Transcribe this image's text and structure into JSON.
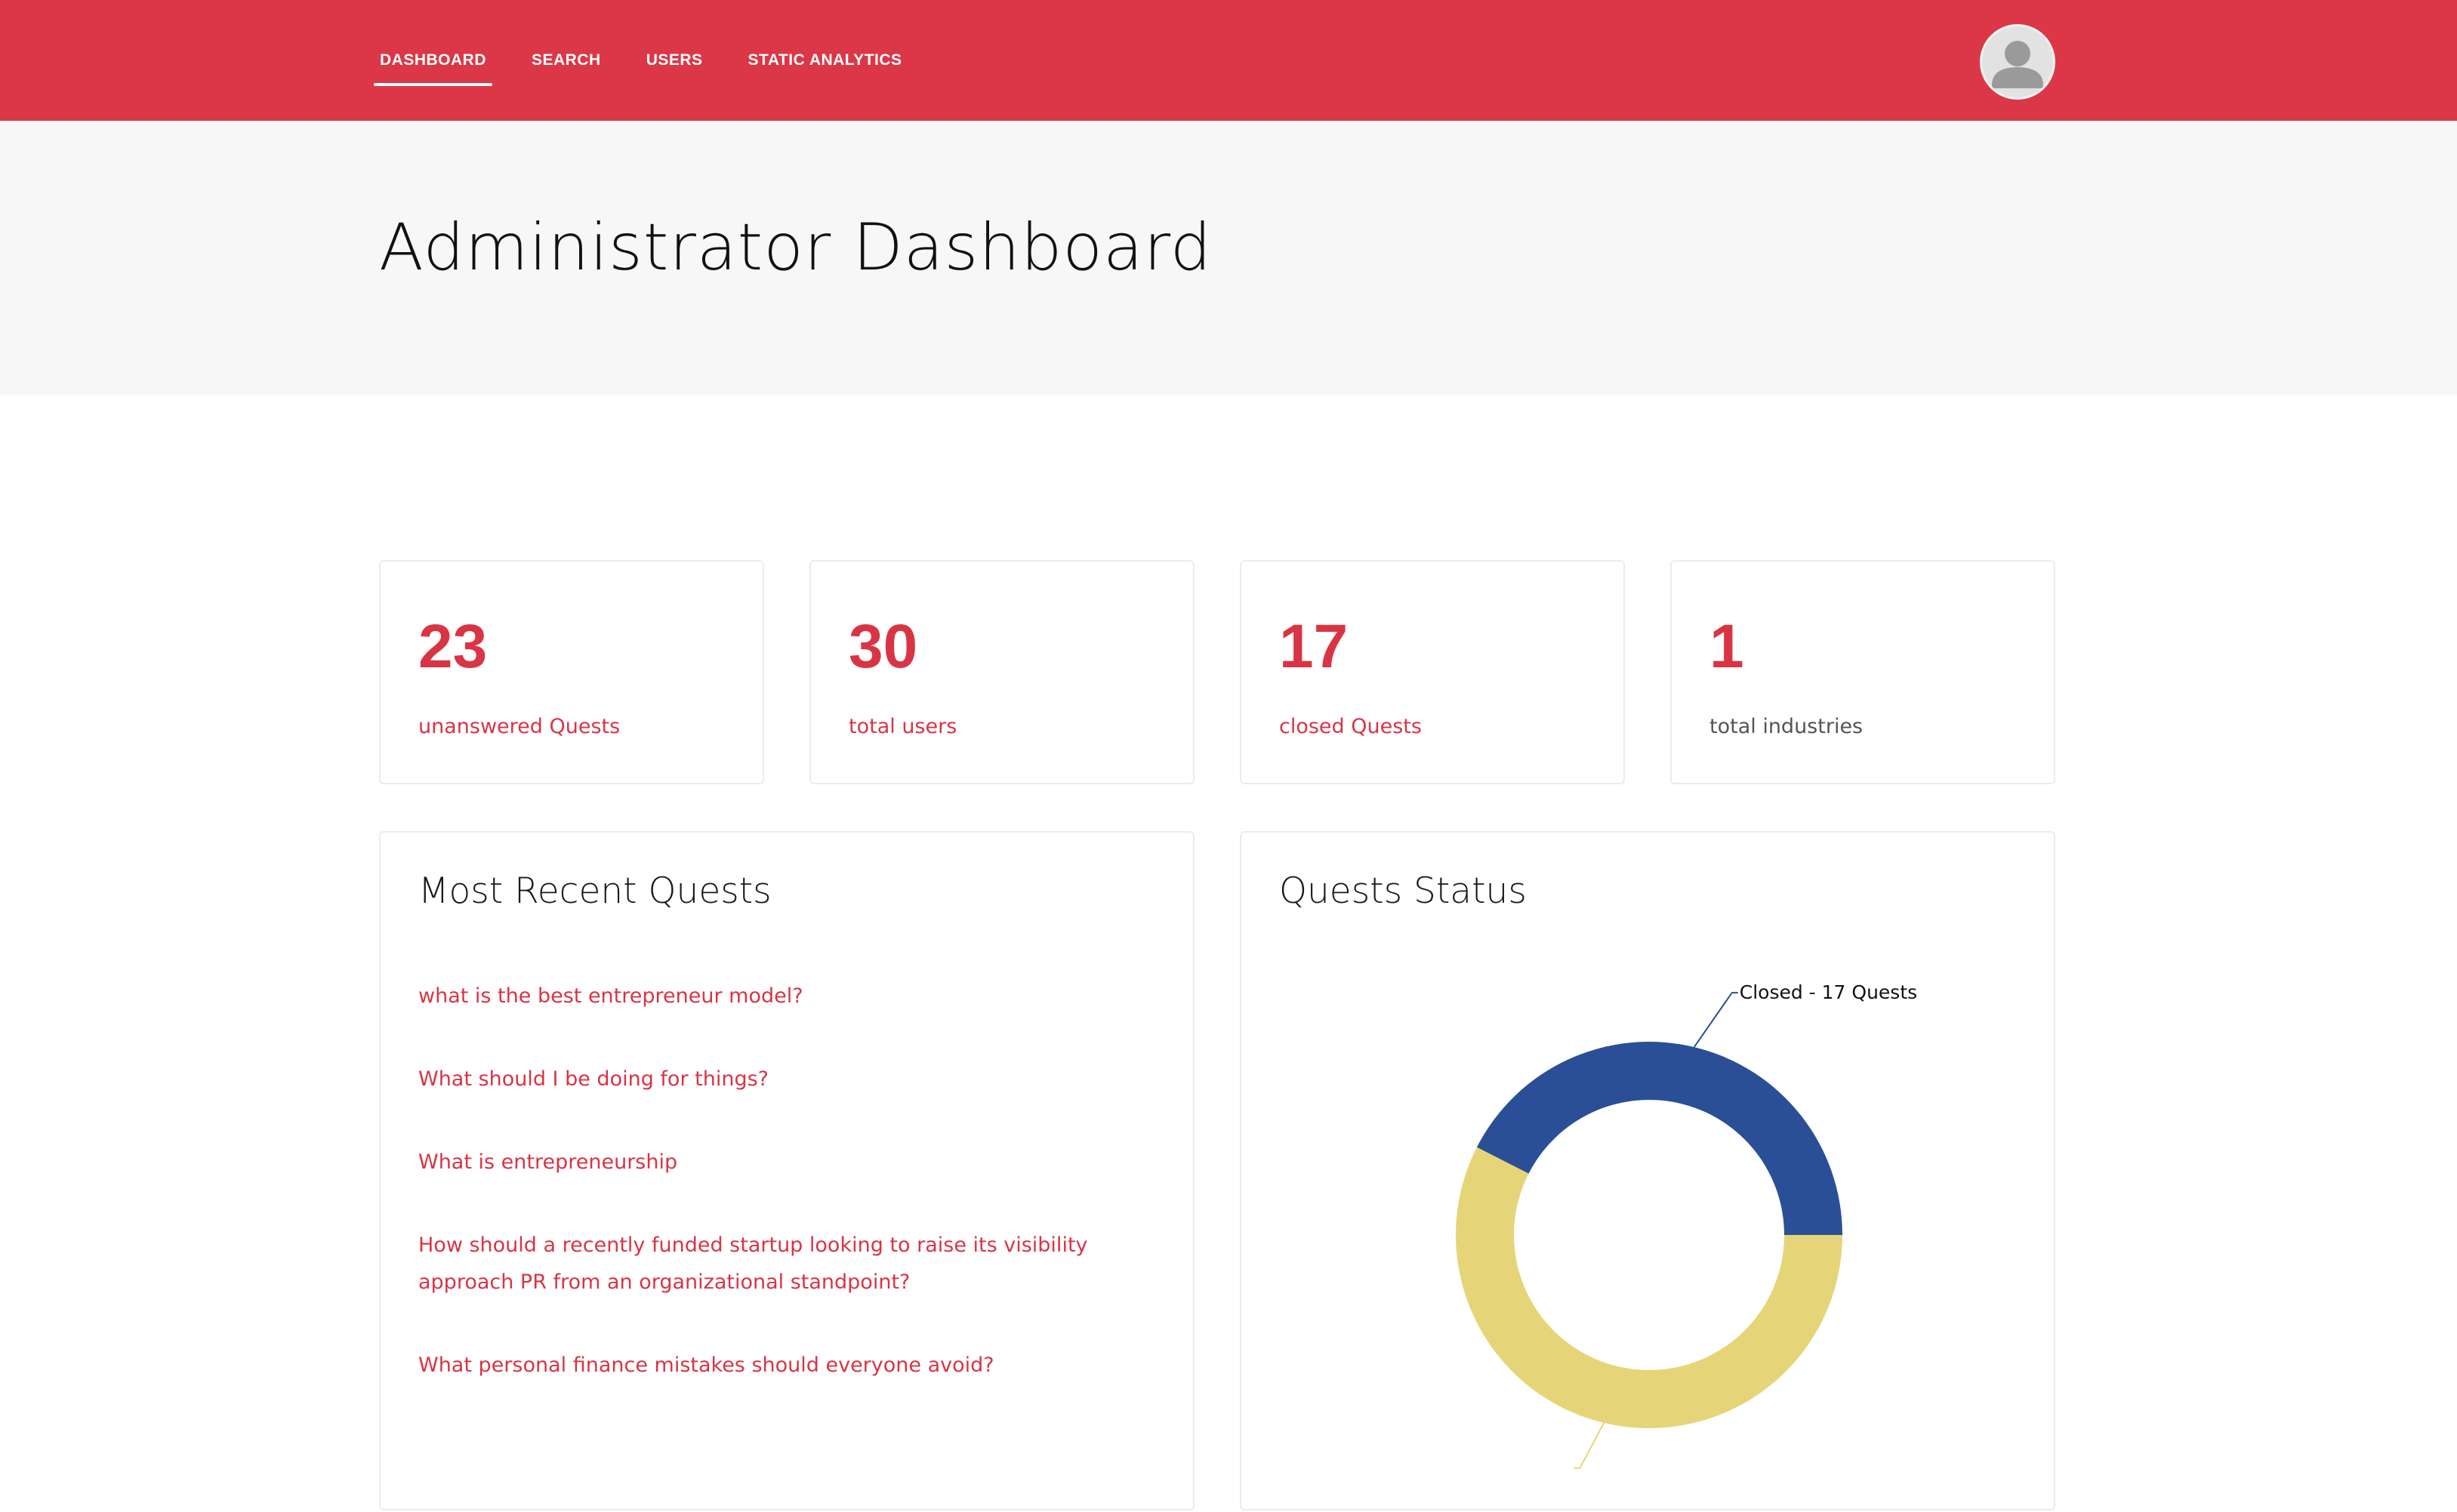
{
  "nav": {
    "items": [
      {
        "label": "DASHBOARD",
        "active": true
      },
      {
        "label": "SEARCH",
        "active": false
      },
      {
        "label": "USERS",
        "active": false
      },
      {
        "label": "STATIC ANALYTICS",
        "active": false
      }
    ],
    "avatar_icon": "user-avatar-icon"
  },
  "header": {
    "title": "Administrator Dashboard"
  },
  "stats": [
    {
      "value": "23",
      "label": "unanswered Quests",
      "label_color": "#d93445"
    },
    {
      "value": "30",
      "label": "total users",
      "label_color": "#d93445"
    },
    {
      "value": "17",
      "label": "closed Quests",
      "label_color": "#d93445"
    },
    {
      "value": "1",
      "label": "total industries",
      "label_color": "#555555"
    }
  ],
  "recent_quests": {
    "title": "Most Recent Quests",
    "items": [
      "what is the best entrepreneur model?",
      "What should I be doing for things?",
      "What is entrepreneurship",
      "How should a recently funded startup looking to raise its visibility approach PR from an organizational standpoint?",
      "What personal finance mistakes should everyone avoid?"
    ]
  },
  "quests_status": {
    "title": "Quests Status"
  },
  "chart_data": {
    "type": "pie",
    "variant": "donut",
    "slices": [
      {
        "label": "Closed - 17 Quests",
        "value": 17,
        "color": "#2b4f96"
      },
      {
        "label": "",
        "value": 23,
        "color": "#e5d578"
      }
    ]
  },
  "colors": {
    "brand": "#dc3747",
    "accent_text": "#d93445",
    "header_band": "#f7f7f7"
  }
}
